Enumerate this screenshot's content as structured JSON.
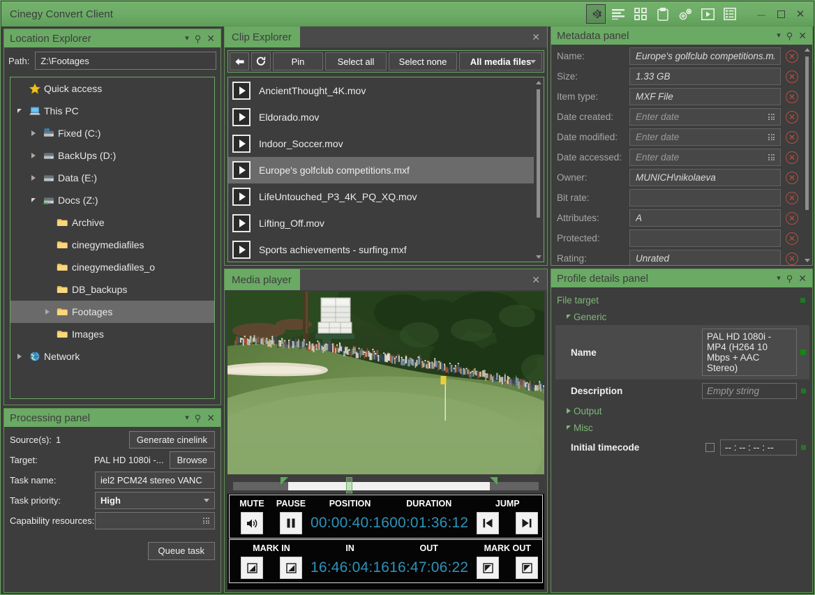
{
  "window": {
    "title": "Cinegy Convert Client",
    "toolbar_icons": [
      "gear-icon",
      "list-icon",
      "grid-icon",
      "clipboard-icon",
      "gears-icon",
      "play-icon",
      "details-icon"
    ],
    "minimize": "—",
    "maximize": "❐",
    "close": "✕"
  },
  "panel_controls": {
    "dropdown": "▾",
    "pin": "✕",
    "close": "✕"
  },
  "location_explorer": {
    "title": "Location Explorer",
    "path_label": "Path:",
    "path_value": "Z:\\Footages",
    "tree": [
      {
        "label": "Quick access",
        "depth": 0,
        "icon": "star-icon",
        "twisty": "none",
        "selected": false
      },
      {
        "label": "This PC",
        "depth": 0,
        "icon": "pc-icon",
        "twisty": "down",
        "selected": false
      },
      {
        "label": "Fixed (C:)",
        "depth": 1,
        "icon": "drive-win-icon",
        "twisty": "right",
        "selected": false
      },
      {
        "label": "BackUps (D:)",
        "depth": 1,
        "icon": "drive-icon",
        "twisty": "right",
        "selected": false
      },
      {
        "label": "Data (E:)",
        "depth": 1,
        "icon": "drive-icon",
        "twisty": "right",
        "selected": false
      },
      {
        "label": "Docs (Z:)",
        "depth": 1,
        "icon": "drive-net-icon",
        "twisty": "down",
        "selected": false
      },
      {
        "label": "Archive",
        "depth": 2,
        "icon": "folder-icon",
        "twisty": "none",
        "selected": false
      },
      {
        "label": "cinegymediafiles",
        "depth": 2,
        "icon": "folder-icon",
        "twisty": "none",
        "selected": false
      },
      {
        "label": "cinegymediafiles_o",
        "depth": 2,
        "icon": "folder-icon",
        "twisty": "none",
        "selected": false
      },
      {
        "label": "DB_backups",
        "depth": 2,
        "icon": "folder-icon",
        "twisty": "none",
        "selected": false
      },
      {
        "label": "Footages",
        "depth": 2,
        "icon": "folder-icon",
        "twisty": "right",
        "selected": true
      },
      {
        "label": "Images",
        "depth": 2,
        "icon": "folder-icon",
        "twisty": "none",
        "selected": false
      },
      {
        "label": "Network",
        "depth": 0,
        "icon": "network-icon",
        "twisty": "right",
        "selected": false
      }
    ]
  },
  "processing_panel": {
    "title": "Processing panel",
    "sources_label": "Source(s):",
    "sources_value": "1",
    "generate_cinelink": "Generate cinelink",
    "target_label": "Target:",
    "target_value": "PAL HD 1080i -...",
    "browse": "Browse",
    "task_name_label": "Task name:",
    "task_name_value": "iel2 PCM24 stereo VANC",
    "task_priority_label": "Task priority:",
    "task_priority_value": "High",
    "capability_label": "Capability resources:",
    "capability_value": "",
    "queue_task": "Queue task"
  },
  "clip_explorer": {
    "title": "Clip Explorer",
    "toolbar": {
      "back": "←",
      "refresh": "↻",
      "pin": "Pin",
      "select_all": "Select all",
      "select_none": "Select none",
      "filter": "All media files"
    },
    "items": [
      {
        "name": "AncientThought_4K.mov",
        "selected": false
      },
      {
        "name": "Eldorado.mov",
        "selected": false
      },
      {
        "name": "Indoor_Soccer.mov",
        "selected": false
      },
      {
        "name": "Europe's golfclub competitions.mxf",
        "selected": true
      },
      {
        "name": "LifeUntouched_P3_4K_PQ_XQ.mov",
        "selected": false
      },
      {
        "name": "Lifting_Off.mov",
        "selected": false
      },
      {
        "name": "Sports achievements - surfing.mxf",
        "selected": false
      }
    ]
  },
  "media_player": {
    "title": "Media player",
    "scrub": {
      "in_percent": 18,
      "out_percent": 84,
      "playhead_percent": 38
    },
    "row1": {
      "h_mute": "MUTE",
      "h_pause": "PAUSE",
      "h_position": "POSITION",
      "h_duration": "DURATION",
      "h_jump": "JUMP",
      "position": "00:00:40:16",
      "duration": "00:01:36:12"
    },
    "row2": {
      "h_mark_in": "MARK IN",
      "h_in": "IN",
      "h_out": "OUT",
      "h_mark_out": "MARK OUT",
      "in": "16:46:04:16",
      "out": "16:47:06:22"
    }
  },
  "metadata_panel": {
    "title": "Metadata panel",
    "rows": [
      {
        "label": "Name:",
        "value": "Europe's golfclub competitions.mxf",
        "placeholder": false,
        "grip": false
      },
      {
        "label": "Size:",
        "value": "1.33 GB",
        "placeholder": false,
        "grip": false
      },
      {
        "label": "Item type:",
        "value": "MXF File",
        "placeholder": false,
        "grip": false
      },
      {
        "label": "Date created:",
        "value": "Enter date",
        "placeholder": true,
        "grip": true
      },
      {
        "label": "Date modified:",
        "value": "Enter date",
        "placeholder": true,
        "grip": true
      },
      {
        "label": "Date accessed:",
        "value": "Enter date",
        "placeholder": true,
        "grip": true
      },
      {
        "label": "Owner:",
        "value": "MUNICH\\nikolaeva",
        "placeholder": false,
        "grip": false
      },
      {
        "label": "Bit rate:",
        "value": "",
        "placeholder": false,
        "grip": false
      },
      {
        "label": "Attributes:",
        "value": "A",
        "placeholder": false,
        "grip": false
      },
      {
        "label": "Protected:",
        "value": "",
        "placeholder": false,
        "grip": false
      },
      {
        "label": "Rating:",
        "value": "Unrated",
        "placeholder": false,
        "grip": false
      }
    ],
    "clear_icon": "✕"
  },
  "profile_details_panel": {
    "title": "Profile details panel",
    "file_target": "File target",
    "generic": "Generic",
    "name_label": "Name",
    "name_value": "PAL HD 1080i - MP4 (H264 10 Mbps + AAC Stereo)",
    "description_label": "Description",
    "description_value": "Empty string",
    "output": "Output",
    "misc": "Misc",
    "initial_timecode_label": "Initial timecode",
    "initial_timecode_value": "-- : -- : -- : --"
  },
  "colors": {
    "accent_green": "#6aaa64",
    "window_bg": "#3d3d3d",
    "timecode_cyan": "#2c93bb",
    "clear_red": "#b5503f",
    "section_green": "#7fb878"
  }
}
